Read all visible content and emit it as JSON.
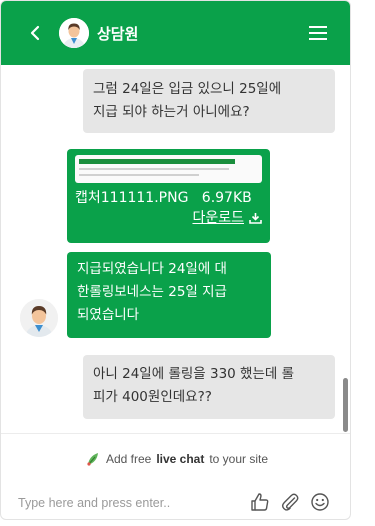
{
  "header": {
    "agent_name": "상담원",
    "back_icon": "chevron-left-icon",
    "menu_icon": "hamburger-menu-icon"
  },
  "messages": [
    {
      "sender": "user",
      "lines": [
        "그럼 24일은 입금 있으니 25일에",
        "지급 되야 하는거 아니에요?"
      ]
    },
    {
      "sender": "agent",
      "type": "file",
      "file_name": "캡처111111.PNG",
      "file_size": "6.97KB",
      "download_label": "다운로드"
    },
    {
      "sender": "agent",
      "lines": [
        "지급되였습니다 24일에 대",
        "한롤링보네스는 25일 지급",
        "되였습니다"
      ]
    },
    {
      "sender": "user",
      "lines": [
        "아니 24일에 롤링을 330 했는데 롤",
        "피가 400원인데요??"
      ]
    }
  ],
  "footer": {
    "powered_prefix": "Add free",
    "powered_bold": "live chat",
    "powered_suffix": "to your site",
    "input_placeholder": "Type here and press enter.."
  },
  "colors": {
    "brand": "#0aa14a",
    "user_bubble": "#e6e6e6"
  }
}
